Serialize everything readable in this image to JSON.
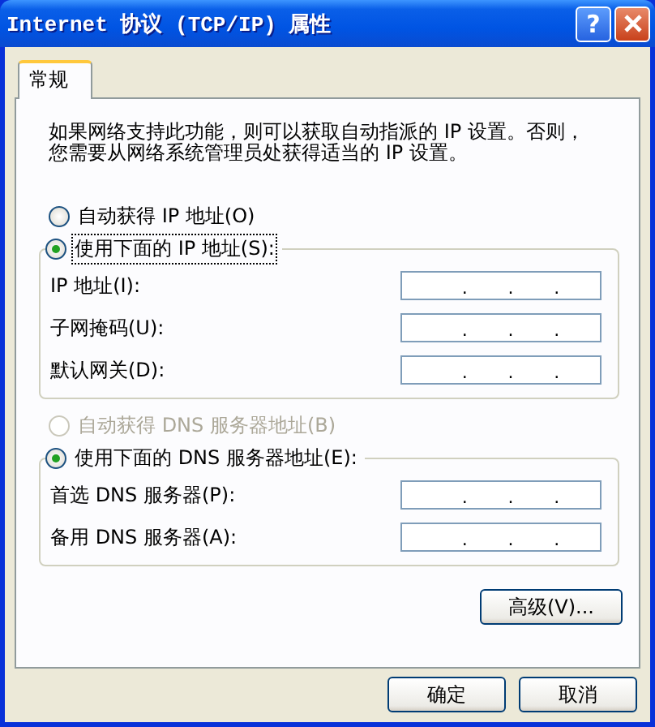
{
  "window": {
    "title": "Internet 协议 (TCP/IP) 属性",
    "help_label": "?"
  },
  "tabs": [
    {
      "label": "常规",
      "selected": true
    }
  ],
  "description_lines": [
    "如果网络支持此功能，则可以获取自动指派的 IP 设置。否则，",
    "您需要从网络系统管理员处获得适当的 IP 设置。"
  ],
  "sections": [
    {
      "radios": [
        {
          "label": "自动获得 IP 地址(O)",
          "selected": false,
          "disabled": false,
          "focused": false
        },
        {
          "label": "使用下面的 IP 地址(S):",
          "selected": true,
          "disabled": false,
          "focused": true
        }
      ],
      "fields": [
        {
          "label": "IP 地址(I):",
          "separators": [
            ".",
            ".",
            "."
          ]
        },
        {
          "label": "子网掩码(U):",
          "separators": [
            ".",
            ".",
            "."
          ]
        },
        {
          "label": "默认网关(D):",
          "separators": [
            ".",
            ".",
            "."
          ]
        }
      ]
    },
    {
      "radios": [
        {
          "label": "自动获得 DNS 服务器地址(B)",
          "selected": false,
          "disabled": true,
          "focused": false
        },
        {
          "label": "使用下面的 DNS 服务器地址(E):",
          "selected": true,
          "disabled": false,
          "focused": false
        }
      ],
      "fields": [
        {
          "label": "首选 DNS 服务器(P):",
          "separators": [
            ".",
            ".",
            "."
          ]
        },
        {
          "label": "备用 DNS 服务器(A):",
          "separators": [
            ".",
            ".",
            "."
          ]
        }
      ]
    }
  ],
  "advanced_button": "高级(V)...",
  "buttons": [
    "确定",
    "取消"
  ]
}
